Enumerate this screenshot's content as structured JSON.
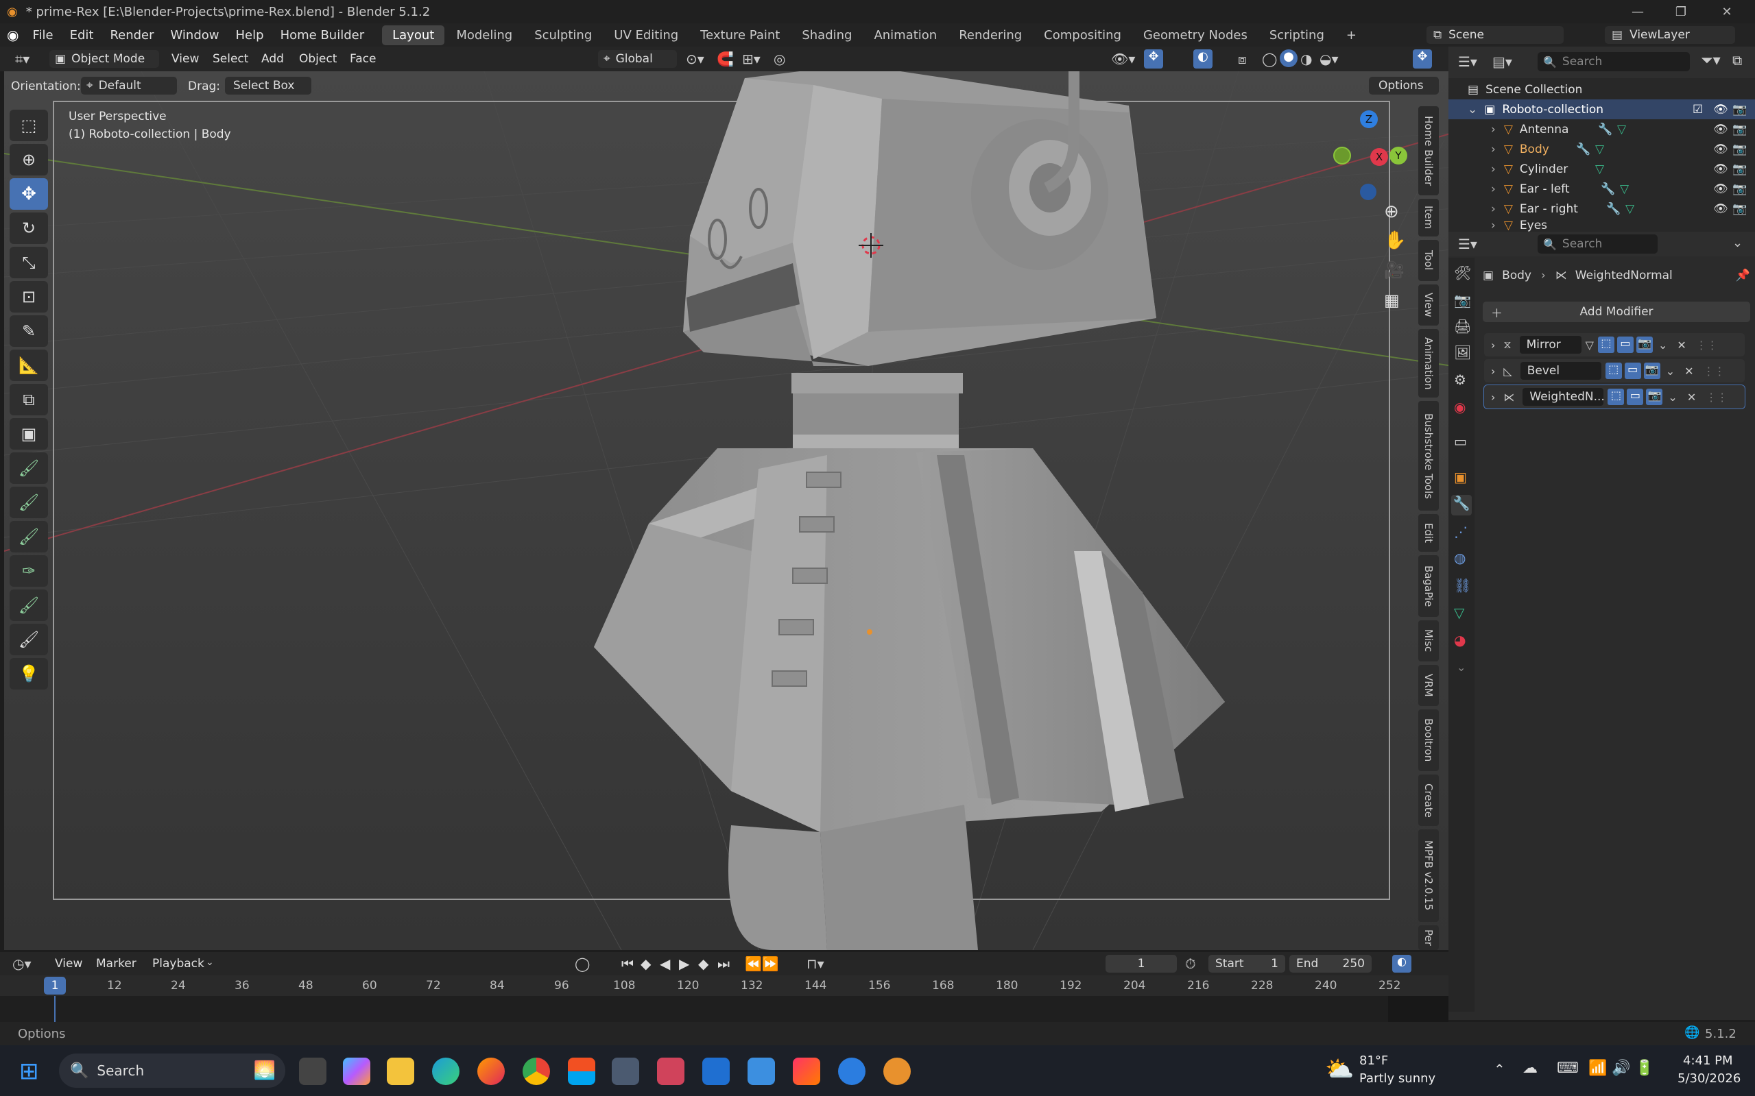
{
  "titlebar": {
    "title": "* prime-Rex [E:\\Blender-Projects\\prime-Rex.blend] - Blender 5.1.2",
    "minimize": "—",
    "restore": "❐",
    "close": "✕"
  },
  "menu": {
    "items": [
      "File",
      "Edit",
      "Render",
      "Window",
      "Help",
      "Home Builder"
    ]
  },
  "workspaces": [
    "Layout",
    "Modeling",
    "Sculpting",
    "UV Editing",
    "Texture Paint",
    "Shading",
    "Animation",
    "Rendering",
    "Compositing",
    "Geometry Nodes",
    "Scripting"
  ],
  "workspace_add": "+",
  "scene": {
    "label": "Scene",
    "viewlayer": "ViewLayer"
  },
  "viewport_header": {
    "mode": "Object Mode",
    "view": "View",
    "select": "Select",
    "add": "Add",
    "object": "Object",
    "face": "Face",
    "transform": "Global"
  },
  "tool_settings": {
    "orientation_label": "Orientation:",
    "orientation_value": "Default",
    "drag_label": "Drag:",
    "drag_value": "Select Box",
    "options": "Options"
  },
  "viewport": {
    "perspective": "User Perspective",
    "collection_info": "(1) Roboto-collection | Body",
    "gizmo": {
      "z": "Z",
      "x": "X",
      "y": "Y"
    }
  },
  "sidebar_tabs": [
    "Home Builder",
    "Item",
    "Tool",
    "View",
    "Animation",
    "Bushstroke Tools",
    "Edit",
    "BagaPie",
    "Misc",
    "VRM",
    "Booltron",
    "Create",
    "MPFB v2.0.15",
    "Per"
  ],
  "outliner": {
    "search_placeholder": "Search",
    "root": "Scene Collection",
    "collection": "Roboto-collection",
    "objects": [
      "Antenna",
      "Body",
      "Cylinder",
      "Ear - left",
      "Ear - right",
      "Eyes"
    ]
  },
  "properties": {
    "search_placeholder": "Search",
    "breadcrumb_object": "Body",
    "breadcrumb_modifier": "WeightedNormal",
    "add_modifier": "Add Modifier",
    "modifiers": [
      "Mirror",
      "Bevel",
      "WeightedN..."
    ]
  },
  "timeline": {
    "view": "View",
    "marker": "Marker",
    "playback": "Playback",
    "current_frame": "1",
    "start_label": "Start",
    "start": "1",
    "end_label": "End",
    "end": "250",
    "frames": [
      "1",
      "12",
      "24",
      "36",
      "48",
      "60",
      "72",
      "84",
      "96",
      "108",
      "120",
      "132",
      "144",
      "156",
      "168",
      "180",
      "192",
      "204",
      "216",
      "228",
      "240",
      "252"
    ]
  },
  "statusbar": {
    "left": "Options",
    "version": "5.1.2"
  },
  "taskbar": {
    "search": "Search",
    "weather_temp": "81°F",
    "weather_desc": "Partly sunny",
    "time": "4:41 PM",
    "date": "5/30/2026"
  },
  "colors": {
    "accent": "#4772b3",
    "orange": "#e8912d",
    "green": "#39b88a",
    "gizmo_x": "#e0384b",
    "gizmo_y": "#8ac53a",
    "gizmo_z": "#2f7fe0"
  }
}
